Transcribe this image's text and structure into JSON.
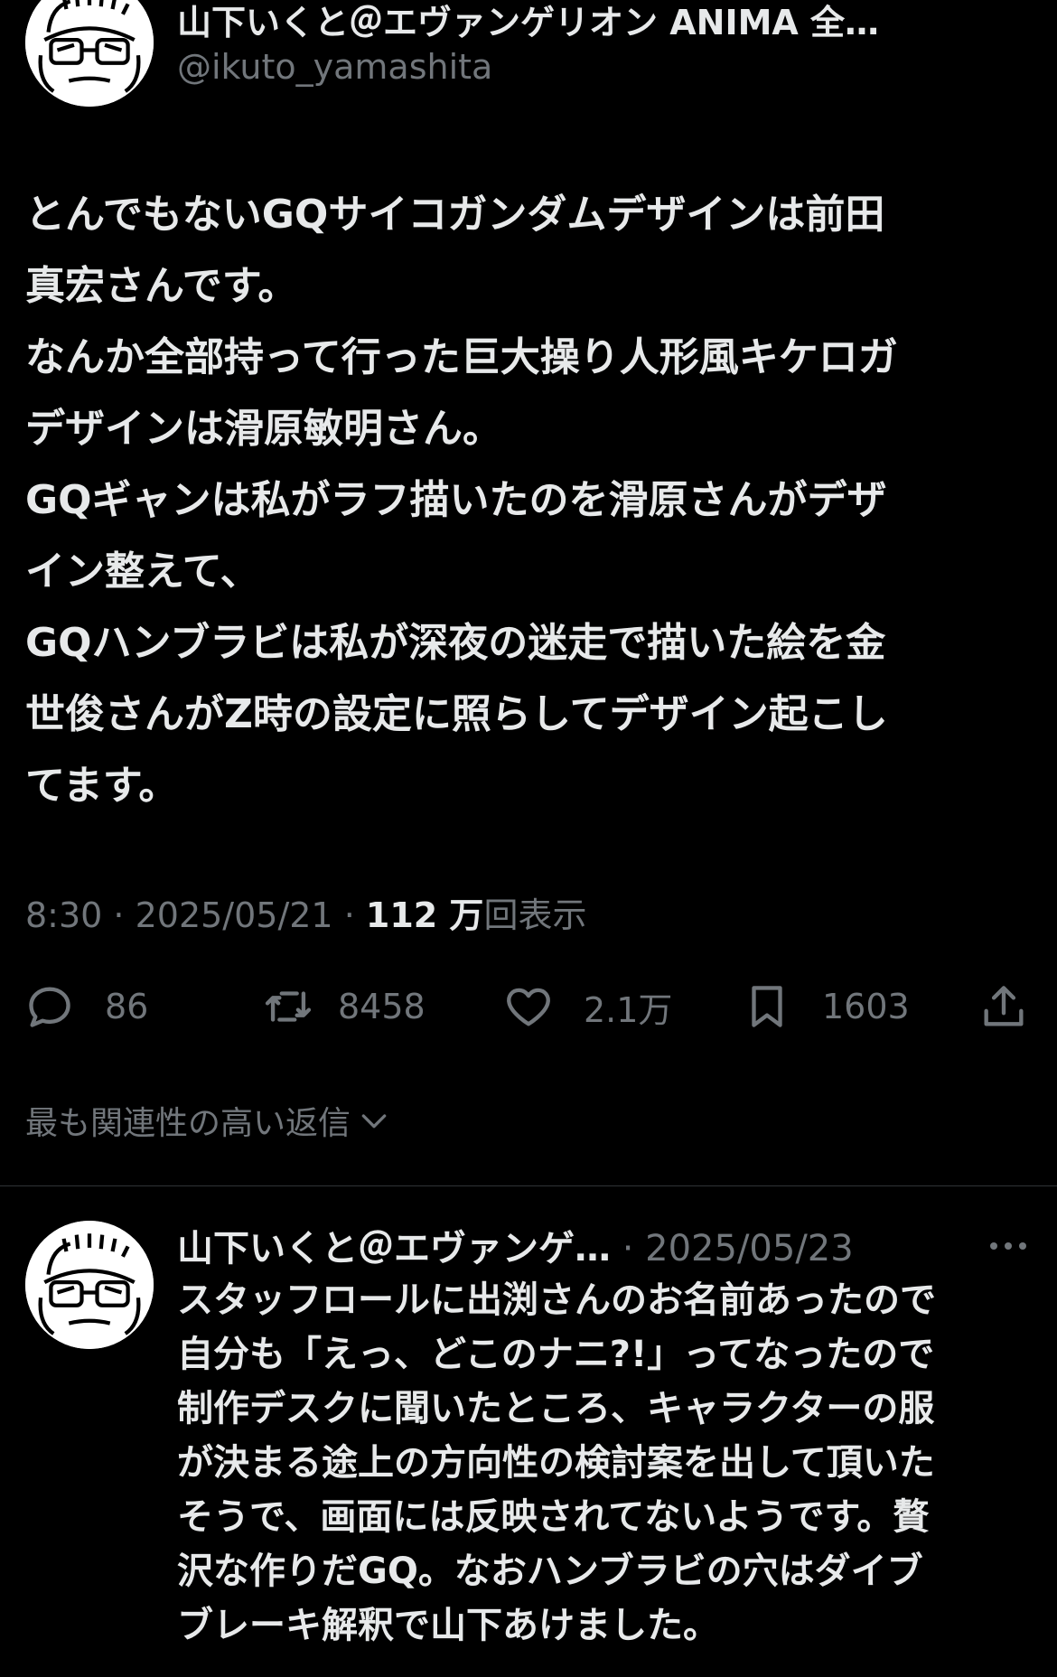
{
  "tweet": {
    "author_name": "山下いくと＠エヴァンゲリオン ANIMA 全…",
    "handle": "@ikuto_yamashita",
    "text": "とんでもないGQサイコガンダムデザインは前田\n真宏さんです。\nなんか全部持って行った巨大操り人形風キケロガ\nデザインは滑原敏明さん。\nGQギャンは私がラフ描いたのを滑原さんがデザ\nイン整えて、\nGQハンブラビは私が深夜の迷走で描いた絵を金\n世俊さんがZ時の設定に照らしてデザイン起こし\nてます。",
    "time": "8:30",
    "date": "2025/05/21",
    "views_number": "112 万",
    "views_label": "回表示",
    "sep": " · ",
    "stats": {
      "replies": "86",
      "retweets": "8458",
      "likes": "2.1万",
      "bookmarks": "1603"
    },
    "icons": {
      "reply": "comment-bubble-icon",
      "retweet": "retweet-icon",
      "like": "heart-icon",
      "bookmark": "bookmark-icon",
      "share": "share-icon"
    }
  },
  "sort_label": "最も関連性の高い返信",
  "reply": {
    "author_name": "山下いくと＠エヴァンゲ…",
    "date": " · 2025/05/23",
    "text": "スタッフロールに出渕さんのお名前あったので\n自分も「えっ、どこのナニ?!」ってなったので\n制作デスクに聞いたところ、キャラクターの服\nが決まる途上の方向性の検討案を出して頂いた\nそうで、画面には反映されてないようです。贅\n沢な作りだGQ。なおハンブラビの穴はダイブ\nブレーキ解釈で山下あけました。"
  },
  "colors": {
    "background": "#000000",
    "text": "#e7e9ea",
    "secondary": "#71767b",
    "divider": "#2f3336"
  }
}
